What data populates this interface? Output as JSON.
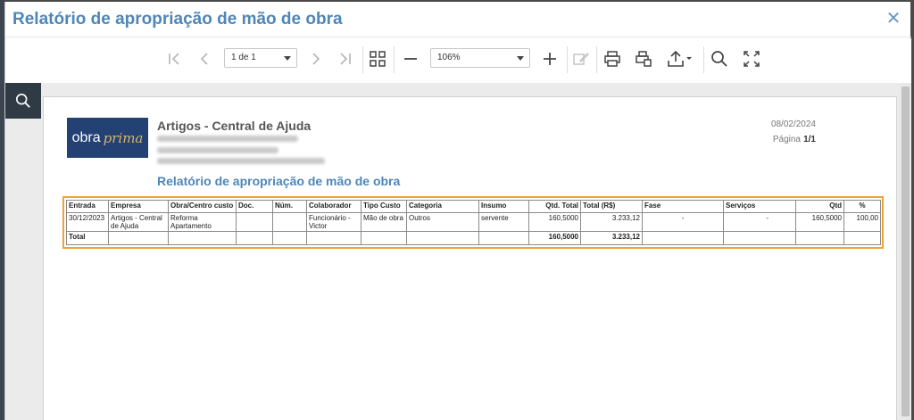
{
  "dialog": {
    "title": "Relatório de apropriação de mão de obra",
    "close_glyph": "✕"
  },
  "toolbar": {
    "page_select": "1 de 1",
    "zoom_select": "106%"
  },
  "report": {
    "company": "Artigos - Central de Ajuda",
    "date": "08/02/2024",
    "page_label": "Página",
    "page_value": "1/1",
    "title": "Relatório de apropriação de mão de obra",
    "logo_text": "obra",
    "logo_script": "prima"
  },
  "table": {
    "headers": [
      "Entrada",
      "Empresa",
      "Obra/Centro custo",
      "Doc.",
      "Núm.",
      "Colaborador",
      "Tipo Custo",
      "Categoria",
      "Insumo",
      "Qtd. Total",
      "Total (R$)",
      "Fase",
      "Serviços",
      "Qtd",
      "%"
    ],
    "row": [
      "30/12/2023",
      "Artigos - Central de Ajuda",
      "Reforma Apartamento",
      "",
      "",
      "Funcionário - Victor",
      "Mão de obra",
      "Outros",
      "servente",
      "160,5000",
      "3.233,12",
      "-",
      "-",
      "160,5000",
      "100,00"
    ],
    "total_label": "Total",
    "total_qtd": "160,5000",
    "total_valor": "3.233,12"
  },
  "colors": {
    "title": "#4e86b8",
    "highlight_border": "#f2a233",
    "logo_bg": "#234173"
  },
  "icons": [
    "first-page-icon",
    "prev-page-icon",
    "next-page-icon",
    "last-page-icon",
    "thumbnails-icon",
    "zoom-out-icon",
    "zoom-in-icon",
    "edit-icon",
    "print-icon",
    "print-preview-icon",
    "export-icon",
    "search-icon",
    "fullscreen-icon",
    "close-icon"
  ]
}
